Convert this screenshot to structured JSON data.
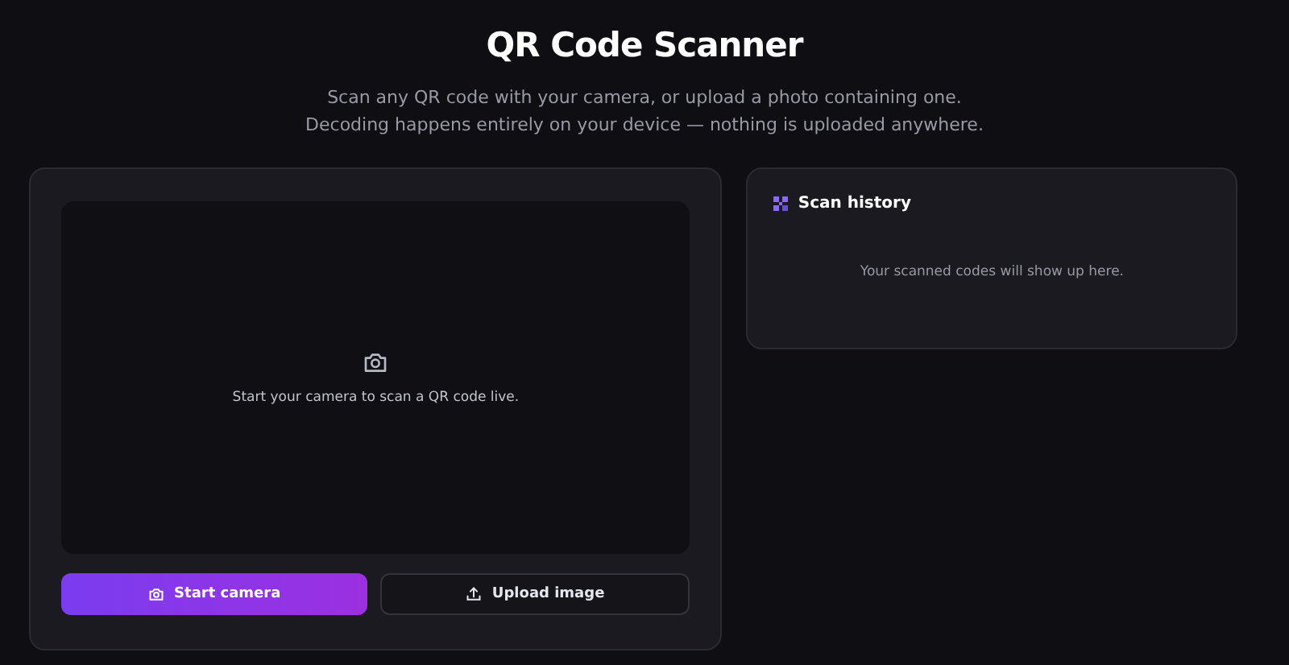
{
  "header": {
    "title": "QR Code Scanner",
    "subtitle_lines": [
      "Scan any QR code with your camera, or upload a photo containing one.",
      "Decoding happens entirely on your device — nothing is uploaded anywhere."
    ]
  },
  "scanner": {
    "hint": "Start your camera to scan a QR code live.",
    "buttons": [
      {
        "kind": "primary",
        "label": "Start camera"
      },
      {
        "kind": "secondary",
        "label": "Upload image"
      }
    ]
  },
  "history": {
    "title": "Scan history",
    "empty_text": "Your scanned codes will show up here."
  }
}
